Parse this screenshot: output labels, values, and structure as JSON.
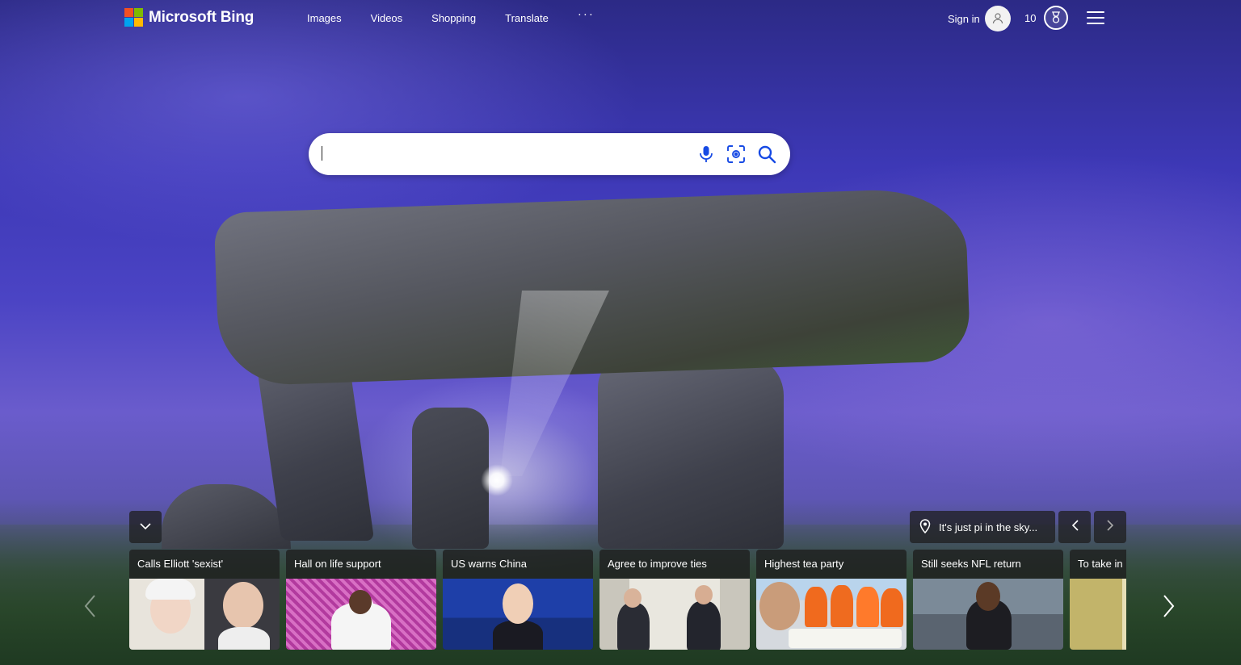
{
  "header": {
    "brand": "Microsoft Bing",
    "brand_colors": [
      "#f25022",
      "#7fba00",
      "#00a4ef",
      "#ffb900"
    ],
    "nav": [
      {
        "label": "Images"
      },
      {
        "label": "Videos"
      },
      {
        "label": "Shopping"
      },
      {
        "label": "Translate"
      },
      {
        "label": "···"
      }
    ],
    "signin_label": "Sign in",
    "rewards_points": "10",
    "icons": {
      "avatar": "user-icon",
      "rewards": "rewards-medal-icon",
      "menu": "hamburger-menu-icon"
    }
  },
  "search": {
    "value": "",
    "placeholder": "",
    "icons": [
      "microphone-icon",
      "visual-search-icon",
      "search-icon"
    ],
    "accent": "#174ae4"
  },
  "image_info": {
    "caption": "It's just pi in the sky...",
    "icons": [
      "location-pin-icon",
      "chevron-left-icon",
      "chevron-right-icon",
      "chevron-down-icon"
    ]
  },
  "news": {
    "cards": [
      {
        "title": "Calls Elliott 'sexist'"
      },
      {
        "title": "Hall on life support"
      },
      {
        "title": "US warns China"
      },
      {
        "title": "Agree to improve ties"
      },
      {
        "title": "Highest tea party"
      },
      {
        "title": "Still seeks NFL return"
      },
      {
        "title": "To take in r"
      }
    ]
  }
}
